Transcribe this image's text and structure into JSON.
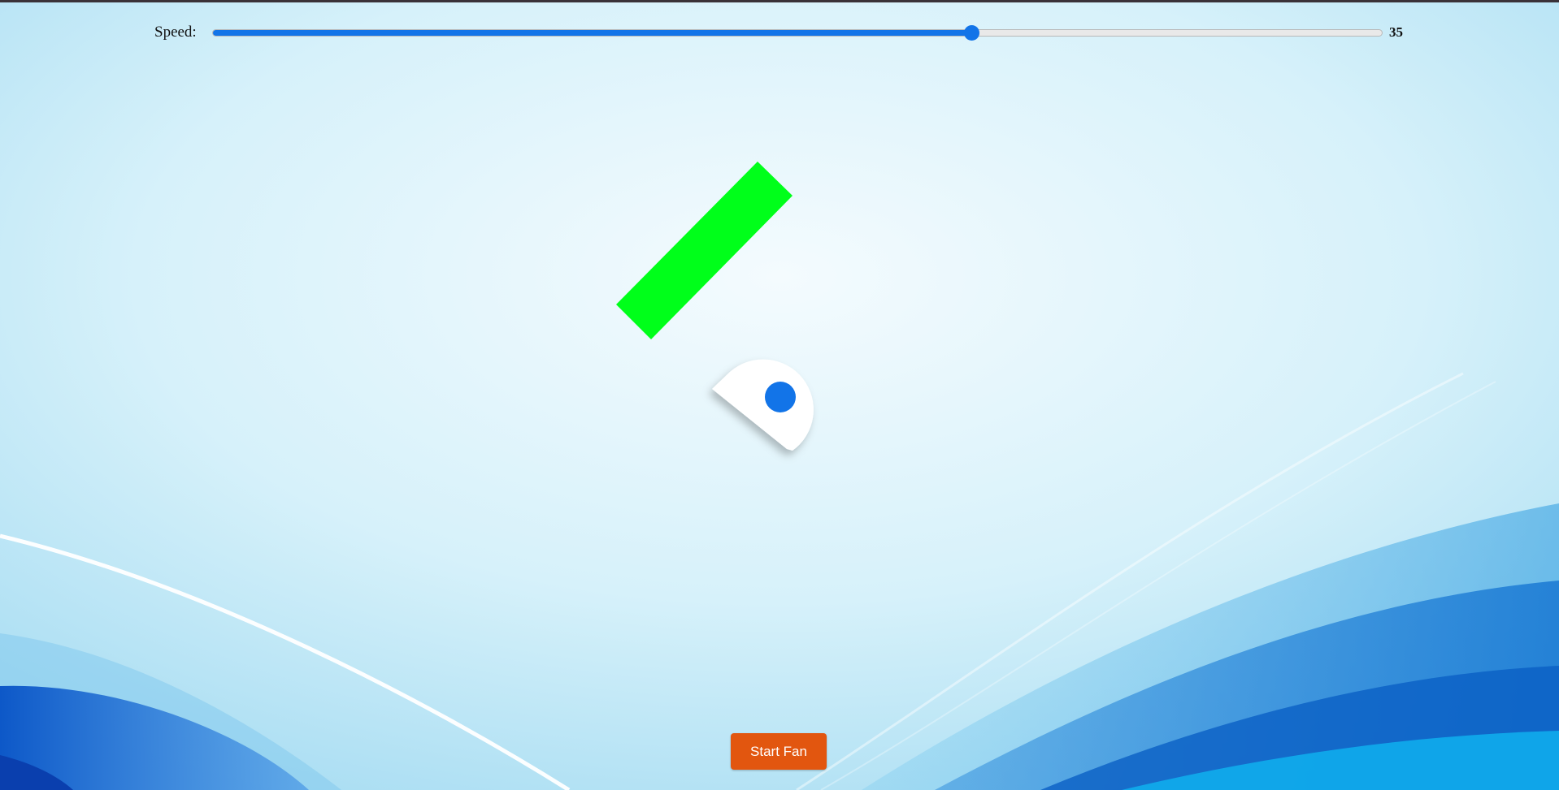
{
  "controls": {
    "speed_label": "Speed:",
    "speed_value": "35",
    "speed_min": 0,
    "speed_max": 54,
    "start_button_label": "Start Fan"
  },
  "colors": {
    "accent": "#1274e8",
    "blade": "#00ff1a",
    "hub": "#ffffff",
    "button": "#e2560f"
  }
}
